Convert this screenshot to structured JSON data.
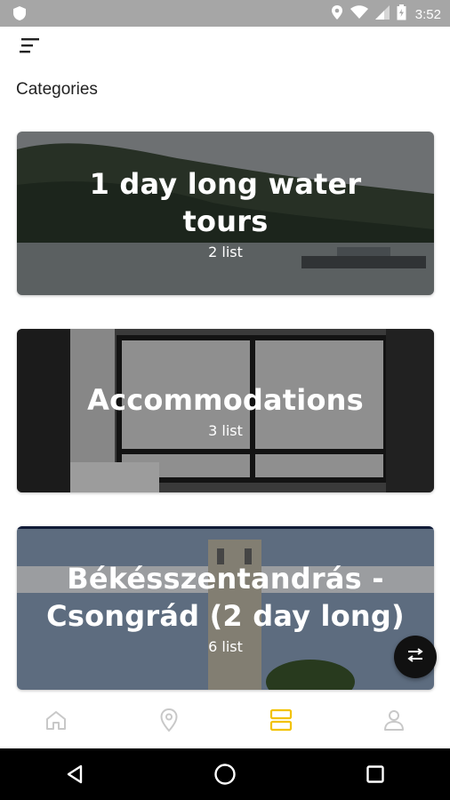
{
  "status_bar": {
    "time": "3:52",
    "icons": [
      "shield-icon",
      "location-icon",
      "wifi-icon",
      "signal-icon",
      "battery-icon"
    ]
  },
  "header": {
    "menu_icon": "menu-icon",
    "title": "Categories"
  },
  "categories": [
    {
      "title": "1 day long water tours",
      "count": "2 list",
      "image": "river-with-boats"
    },
    {
      "title": "Accommodations",
      "count": "3 list",
      "image": "room-with-window"
    },
    {
      "title": "Békésszentandrás - Csongrád (2 day long)",
      "count": "6 list",
      "image": "tower-and-trees"
    }
  ],
  "fab": {
    "icon": "swap-icon"
  },
  "bottom_nav": {
    "items": [
      {
        "icon": "home-icon",
        "active": false
      },
      {
        "icon": "location-pin-icon",
        "active": false
      },
      {
        "icon": "categories-icon",
        "active": true
      },
      {
        "icon": "profile-icon",
        "active": false
      }
    ],
    "active_color": "#f2c200",
    "inactive_color": "#c8c8c8"
  },
  "system_nav": [
    "back-icon",
    "home-circle-icon",
    "recents-icon"
  ]
}
